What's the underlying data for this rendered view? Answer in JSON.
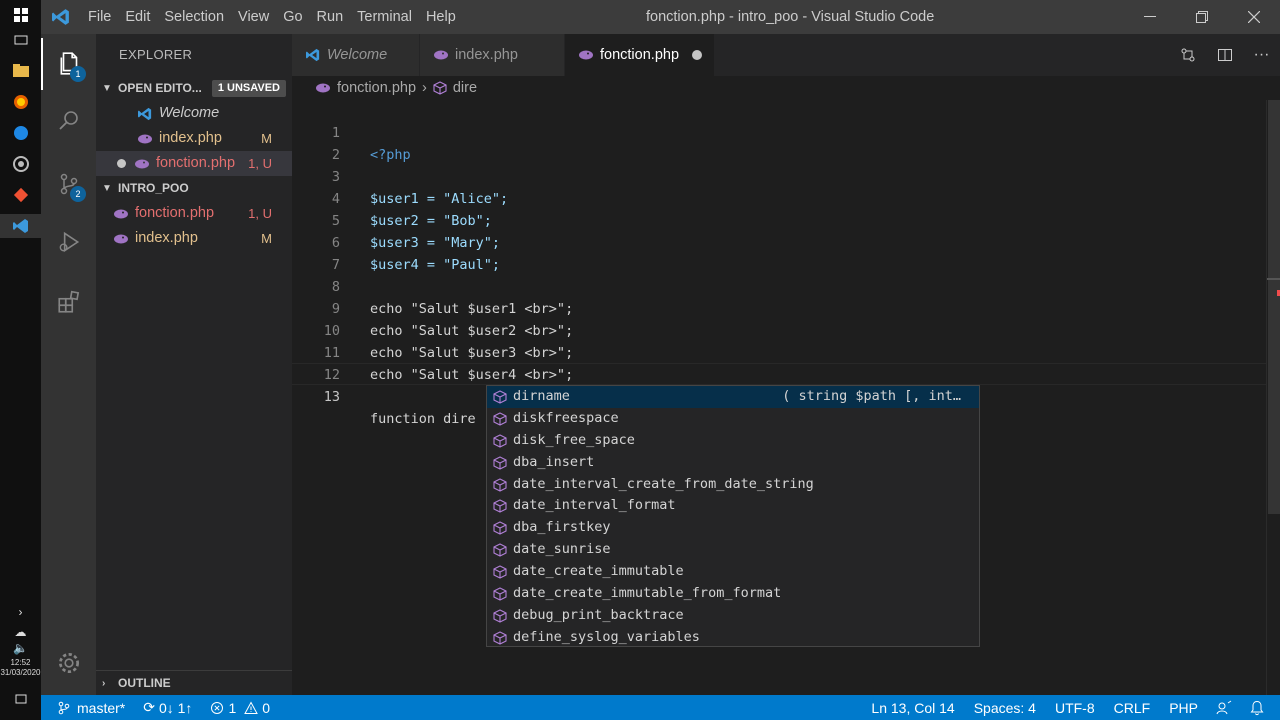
{
  "os_taskbar": {
    "clock_time": "12:52",
    "clock_date": "31/03/2020"
  },
  "titlebar": {
    "menu": [
      "File",
      "Edit",
      "Selection",
      "View",
      "Go",
      "Run",
      "Terminal",
      "Help"
    ],
    "window_title": "fonction.php - intro_poo - Visual Studio Code"
  },
  "activity": {
    "explorer_badge": "1",
    "scm_badge": "2"
  },
  "sidebar": {
    "title": "EXPLORER",
    "open_editors_label": "OPEN EDITO...",
    "open_editors_badge": "1 UNSAVED",
    "open_editors": [
      {
        "name": "Welcome",
        "status": ""
      },
      {
        "name": "index.php",
        "status": "M"
      },
      {
        "name": "fonction.php",
        "status": "1, U"
      }
    ],
    "project_label": "INTRO_POO",
    "project_files": [
      {
        "name": "fonction.php",
        "status": "1, U"
      },
      {
        "name": "index.php",
        "status": "M"
      }
    ],
    "outline_label": "OUTLINE"
  },
  "tabs": [
    {
      "label": "Welcome"
    },
    {
      "label": "index.php"
    },
    {
      "label": "fonction.php"
    }
  ],
  "breadcrumb": {
    "file": "fonction.php",
    "symbol": "dire"
  },
  "editor": {
    "lines": [
      {
        "num": "1",
        "text": "<?php"
      },
      {
        "num": "2",
        "text": ""
      },
      {
        "num": "3",
        "text": "$user1 = \"Alice\";"
      },
      {
        "num": "4",
        "text": "$user2 = \"Bob\";"
      },
      {
        "num": "5",
        "text": "$user3 = \"Mary\";"
      },
      {
        "num": "6",
        "text": "$user4 = \"Paul\";"
      },
      {
        "num": "7",
        "text": ""
      },
      {
        "num": "8",
        "text": "echo \"Salut $user1 <br>\";"
      },
      {
        "num": "9",
        "text": "echo \"Salut $user2 <br>\";"
      },
      {
        "num": "10",
        "text": "echo \"Salut $user3 <br>\";"
      },
      {
        "num": "11",
        "text": "echo \"Salut $user4 <br>\";"
      },
      {
        "num": "12",
        "text": ""
      },
      {
        "num": "13",
        "text": "function dire"
      }
    ]
  },
  "suggest": {
    "detail": "( string $path [, int…",
    "items": [
      "dirname",
      "diskfreespace",
      "disk_free_space",
      "dba_insert",
      "date_interval_create_from_date_string",
      "date_interval_format",
      "dba_firstkey",
      "date_sunrise",
      "date_create_immutable",
      "date_create_immutable_from_format",
      "debug_print_backtrace",
      "define_syslog_variables"
    ]
  },
  "statusbar": {
    "branch": "master*",
    "sync": "0↓ 1↑",
    "errors": "1",
    "warnings": "0",
    "position": "Ln 13, Col 14",
    "spaces": "Spaces: 4",
    "encoding": "UTF-8",
    "eol": "CRLF",
    "language": "PHP"
  },
  "colors": {
    "accent": "#007acc",
    "php_icon": "#a074c4",
    "vscode_blue": "#3c99dc",
    "untracked": "#e36f6f",
    "modified": "#e2c08d"
  }
}
